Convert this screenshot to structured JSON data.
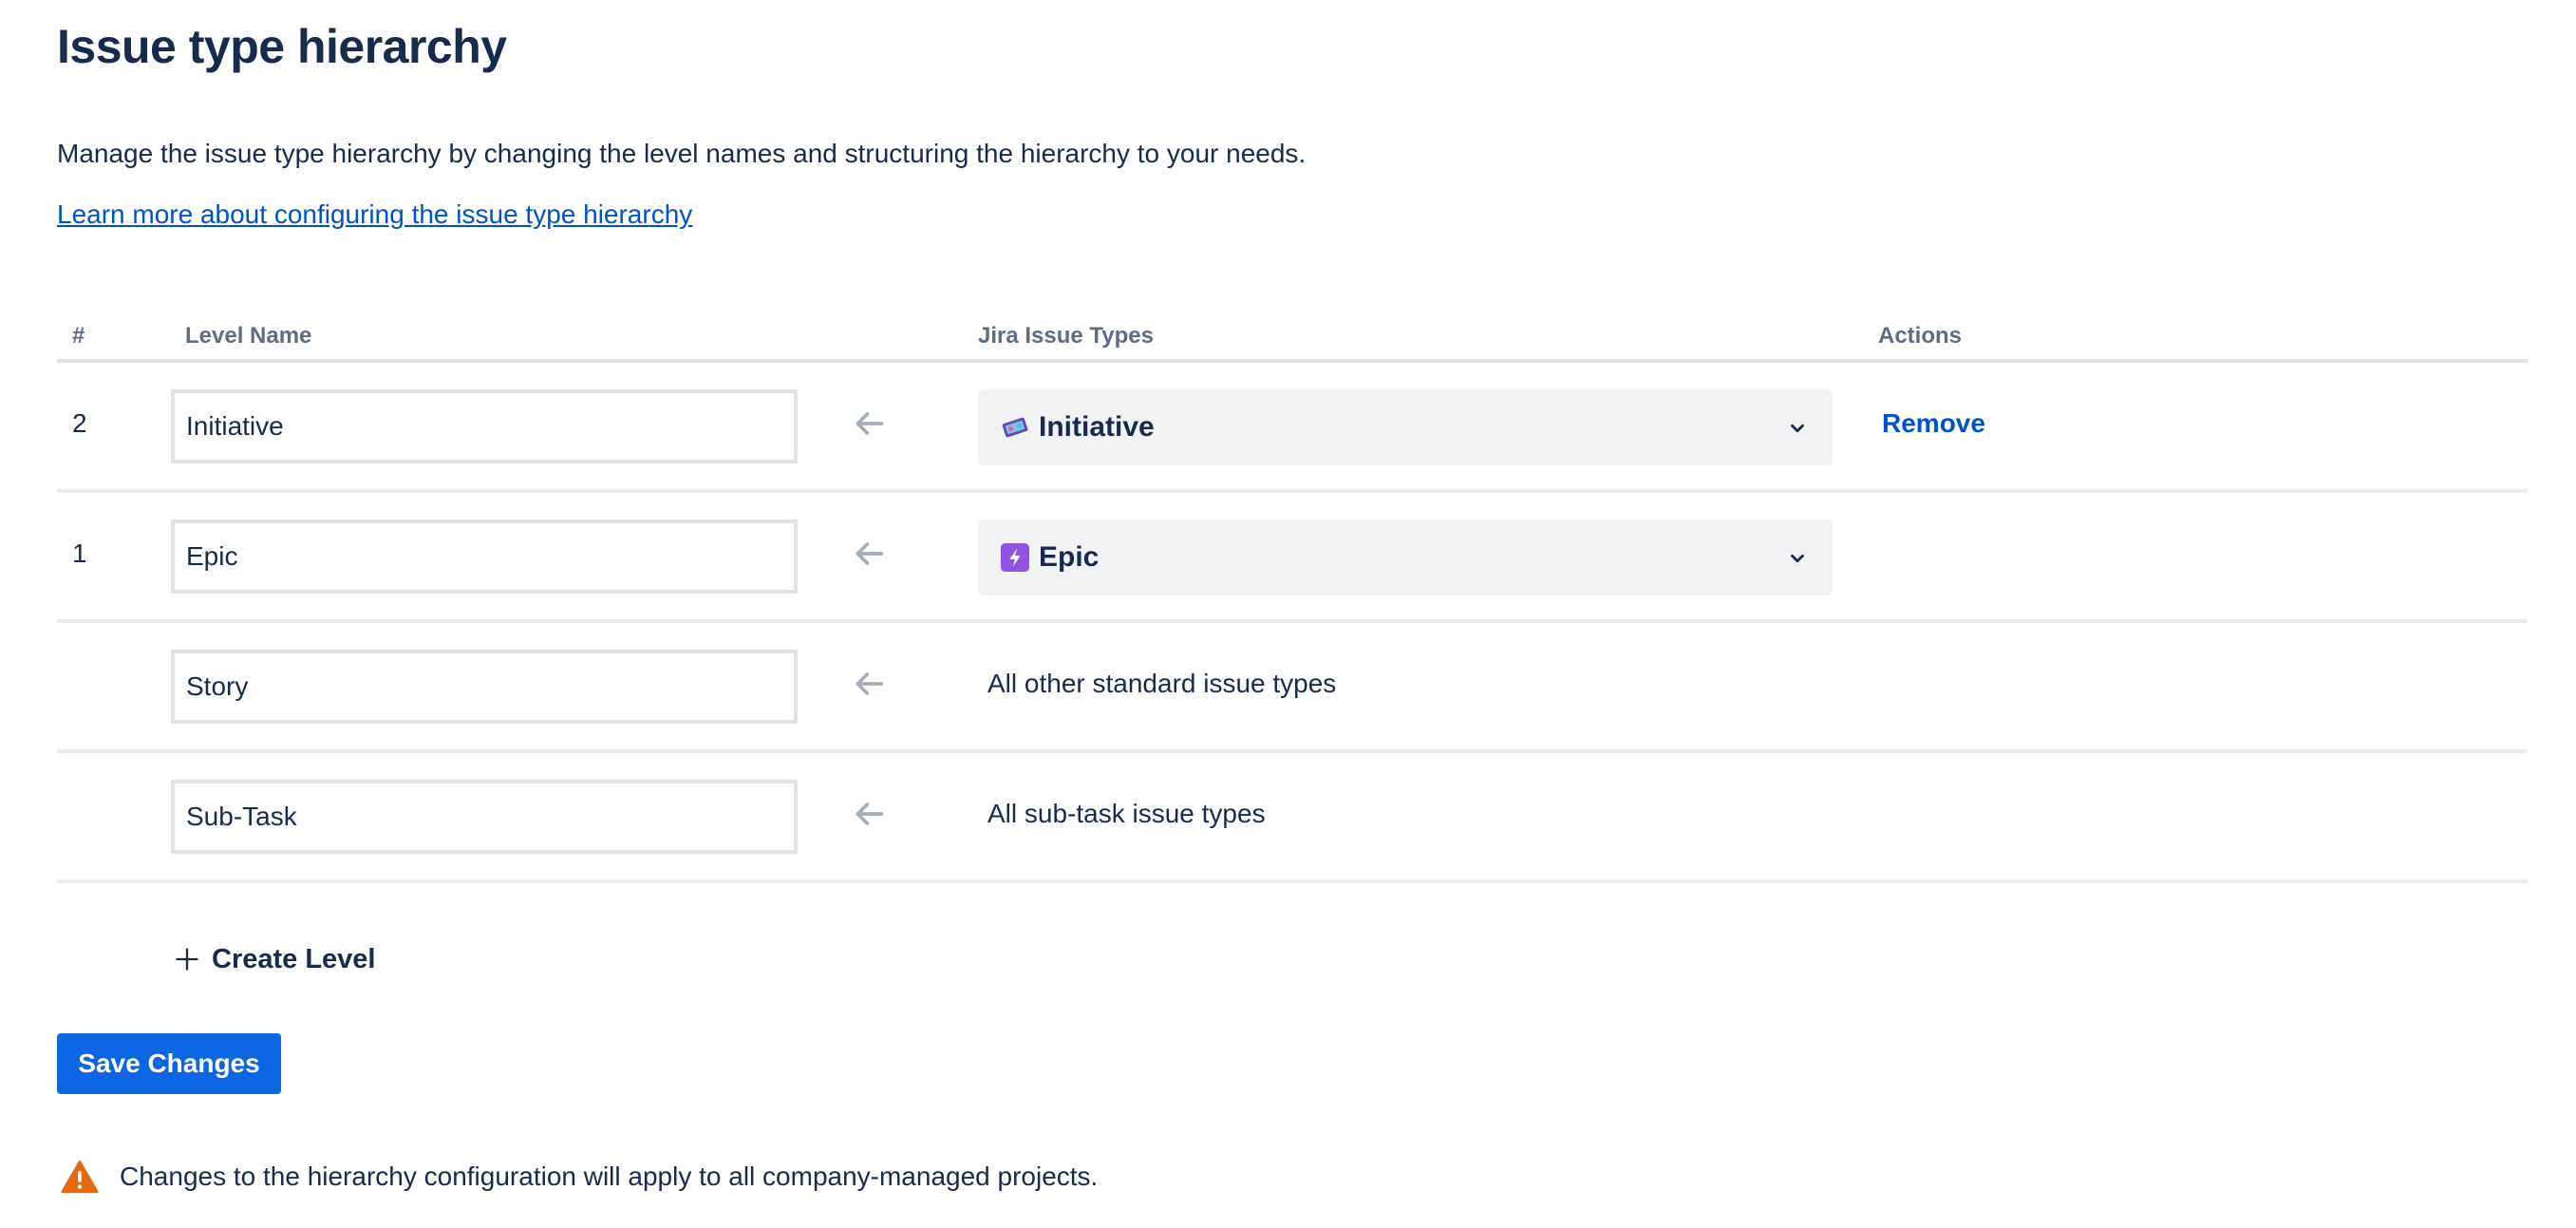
{
  "header": {
    "title": "Issue type hierarchy",
    "description": "Manage the issue type hierarchy by changing the level names and structuring the hierarchy to your needs.",
    "learn_more_link": "Learn more about configuring the issue type hierarchy"
  },
  "table": {
    "columns": {
      "num": "#",
      "level_name": "Level Name",
      "issue_types": "Jira Issue Types",
      "actions": "Actions"
    },
    "rows": [
      {
        "num": "2",
        "level_name": "Initiative",
        "issue_type": "Initiative",
        "issue_type_icon": "initiative-icon",
        "action": "Remove"
      },
      {
        "num": "1",
        "level_name": "Epic",
        "issue_type": "Epic",
        "issue_type_icon": "epic-lightning-icon",
        "action": ""
      },
      {
        "num": "",
        "level_name": "Story",
        "issue_type_text": "All other standard issue types"
      },
      {
        "num": "",
        "level_name": "Sub-Task",
        "issue_type_text": "All sub-task issue types"
      }
    ]
  },
  "actions": {
    "create_level": "Create Level",
    "save_changes": "Save Changes"
  },
  "warning": {
    "text": "Changes to the hierarchy configuration will apply to all company-managed projects."
  },
  "colors": {
    "primary_text": "#172B4D",
    "link": "#0052CC",
    "button": "#0C66E4",
    "warning": "#E56910",
    "epic": "#8F52E3"
  }
}
